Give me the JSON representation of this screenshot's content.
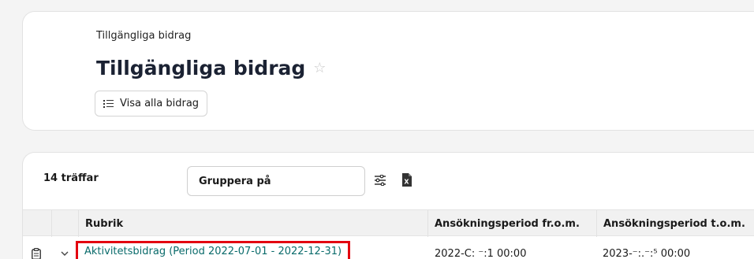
{
  "header": {
    "breadcrumb": "Tillgängliga bidrag",
    "title": "Tillgängliga bidrag",
    "view_all_button": "Visa alla bidrag"
  },
  "list": {
    "count_text": "14 träffar",
    "group_by_placeholder": "Gruppera på",
    "columns": [
      "Rubrik",
      "Ansökningsperiod fr.o.m.",
      "Ansökningsperiod t.o.m."
    ],
    "rows": [
      {
        "title": "Aktivitetsbidrag (Period 2022-07-01 - 2022-12-31)",
        "from": "2022-C: ⁻:1 00:00",
        "to": "2023-⁻:.⁻:⁵ 00:00"
      }
    ]
  },
  "colors": {
    "link": "#0a6b6b",
    "highlight_border": "#e3000f",
    "background": "#f4f4f4"
  }
}
